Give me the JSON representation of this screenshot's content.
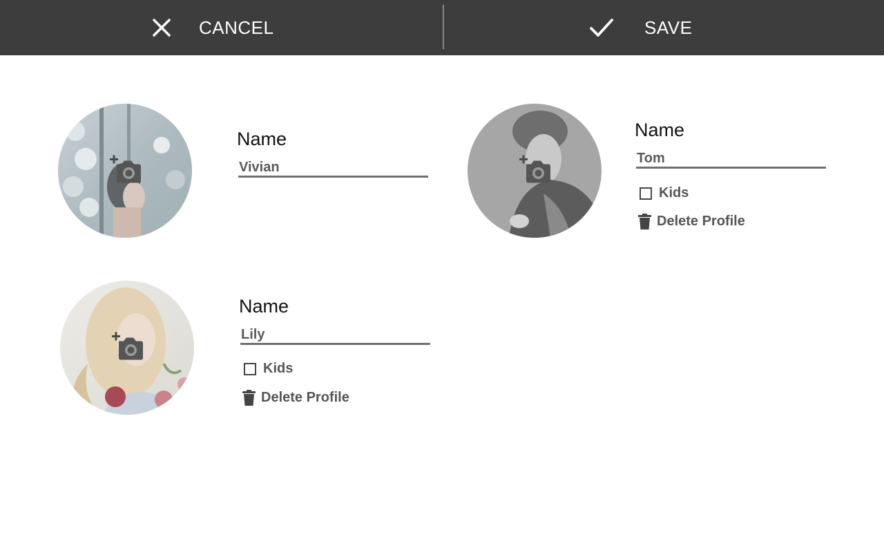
{
  "toolbar": {
    "cancel_label": "CANCEL",
    "save_label": "SAVE",
    "cancel_icon": "close-icon",
    "save_icon": "check-icon",
    "background": "#3d3d3d"
  },
  "profiles": [
    {
      "name_title": "Name",
      "name_value": "Vivian",
      "avatar_icon": "add-photo-icon"
    },
    {
      "name_title": "Name",
      "name_value": "Tom",
      "kids_label": "Kids",
      "kids_checked": false,
      "delete_label": "Delete Profile",
      "avatar_icon": "add-photo-icon"
    },
    {
      "name_title": "Name",
      "name_value": "Lily",
      "kids_label": "Kids",
      "kids_checked": false,
      "delete_label": "Delete Profile",
      "avatar_icon": "add-photo-icon"
    }
  ]
}
